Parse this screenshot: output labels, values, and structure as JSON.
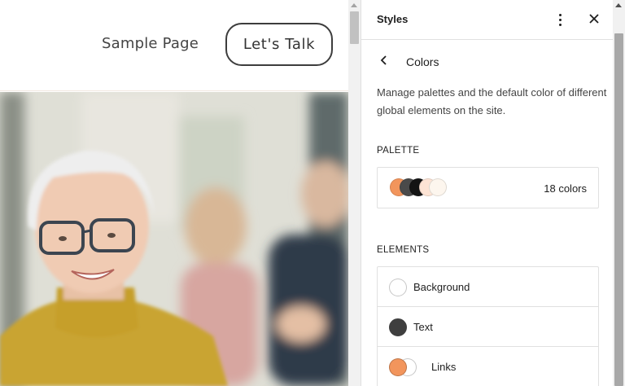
{
  "site": {
    "nav_link": "Sample Page",
    "cta_button": "Let's  Talk"
  },
  "hero": {
    "image": "portrait-photo",
    "alt": "Smiling woman with short white hair and glasses wearing a mustard turtleneck"
  },
  "styles_panel": {
    "title": "Styles",
    "more_icon": "more-vertical-icon",
    "close_icon": "close-icon",
    "back_icon": "chevron-left-icon",
    "screen_title": "Colors",
    "description": "Manage palettes and the default color of different global elements on the site.",
    "palette": {
      "label": "PALETTE",
      "count": "18 colors",
      "swatches": [
        "#f2955c",
        "#4a4a4a",
        "#141414",
        "#fde4d5",
        "#fdf6ee"
      ]
    },
    "elements": {
      "label": "ELEMENTS",
      "items": [
        {
          "label": "Background",
          "colors": [
            "#ffffff"
          ]
        },
        {
          "label": "Text",
          "colors": [
            "#3f3f3f"
          ]
        },
        {
          "label": "Links",
          "colors": [
            "#f2955c",
            "#ffffff"
          ]
        }
      ]
    }
  },
  "colors": {
    "accent": "#f2955c",
    "text": "#1e1e1e",
    "border": "#e0e0e0"
  }
}
